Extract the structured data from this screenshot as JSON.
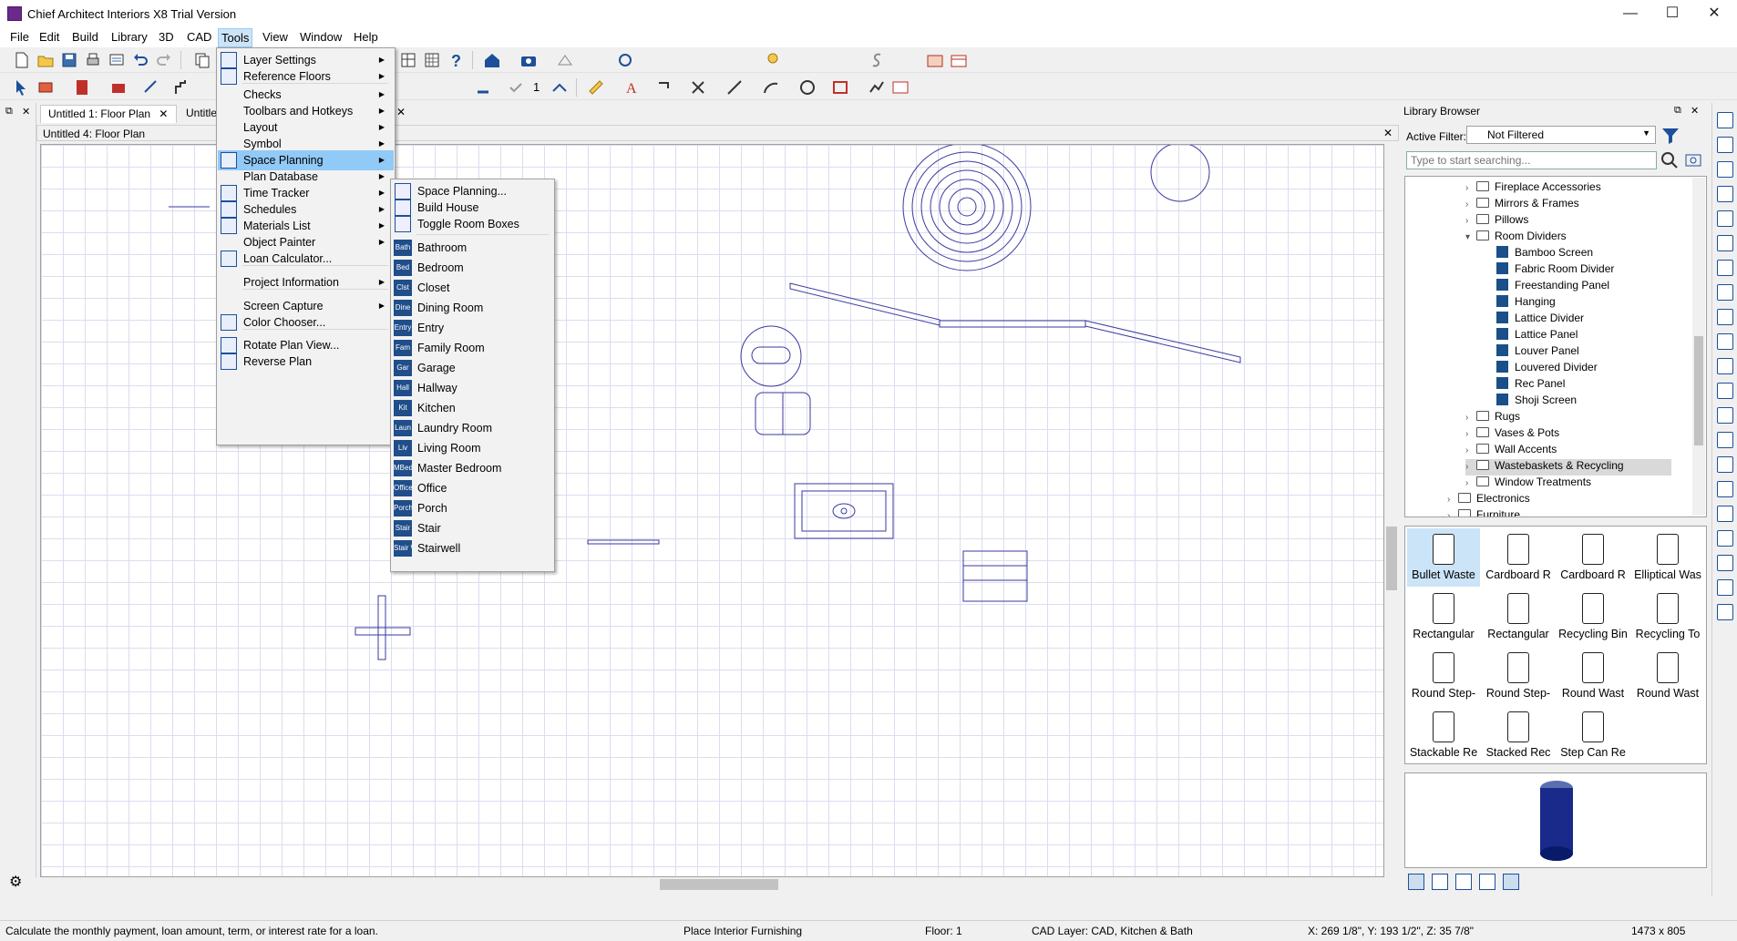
{
  "window": {
    "title": "Chief Architect Interiors X8 Trial Version",
    "minimize": "—",
    "maximize": "☐",
    "close": "✕"
  },
  "menubar": [
    "File",
    "Edit",
    "Build",
    "Library",
    "3D",
    "CAD",
    "Tools",
    "View",
    "Window",
    "Help"
  ],
  "tabs": [
    {
      "label": "Untitled 1: Floor Plan",
      "close": "✕"
    },
    {
      "label": "Untitled",
      "close": "✕"
    }
  ],
  "doc": {
    "header": "Untitled 4: Floor Plan",
    "close": "✕"
  },
  "toolbar": {
    "count": "1"
  },
  "tools_menu": {
    "items": [
      {
        "label": "Layer Settings",
        "submenu": true
      },
      {
        "label": "Reference Floors",
        "submenu": true
      },
      {
        "label": "Checks",
        "submenu": true
      },
      {
        "label": "Toolbars and Hotkeys",
        "submenu": true
      },
      {
        "label": "Layout",
        "submenu": true
      },
      {
        "label": "Symbol",
        "submenu": true
      },
      {
        "label": "Space Planning",
        "submenu": true
      },
      {
        "label": "Plan Database",
        "submenu": true
      },
      {
        "label": "Time Tracker",
        "submenu": true
      },
      {
        "label": "Schedules",
        "submenu": true
      },
      {
        "label": "Materials List",
        "submenu": true
      },
      {
        "label": "Object Painter",
        "submenu": true
      },
      {
        "label": "Loan Calculator...",
        "submenu": false
      },
      {
        "label": "Project Information",
        "submenu": true
      },
      {
        "label": "Screen Capture",
        "submenu": true
      },
      {
        "label": "Color Chooser...",
        "submenu": false
      },
      {
        "label": "Rotate Plan View...",
        "submenu": false
      },
      {
        "label": "Reverse Plan",
        "submenu": false
      }
    ]
  },
  "space_planning_menu": {
    "items": [
      {
        "label": "Space Planning..."
      },
      {
        "label": "Build House"
      },
      {
        "label": "Toggle Room Boxes"
      },
      {
        "label": "Bathroom",
        "icon": "Bath"
      },
      {
        "label": "Bedroom",
        "icon": "Bed"
      },
      {
        "label": "Closet",
        "icon": "Clst"
      },
      {
        "label": "Dining Room",
        "icon": "Dine"
      },
      {
        "label": "Entry",
        "icon": "Entry"
      },
      {
        "label": "Family Room",
        "icon": "Fam"
      },
      {
        "label": "Garage",
        "icon": "Gar"
      },
      {
        "label": "Hallway",
        "icon": "Hall"
      },
      {
        "label": "Kitchen",
        "icon": "Kit"
      },
      {
        "label": "Laundry Room",
        "icon": "Laun"
      },
      {
        "label": "Living Room",
        "icon": "Liv"
      },
      {
        "label": "Master Bedroom",
        "icon": "MBed"
      },
      {
        "label": "Office",
        "icon": "Office"
      },
      {
        "label": "Porch",
        "icon": "Porch"
      },
      {
        "label": "Stair",
        "icon": "Stair"
      },
      {
        "label": "Stairwell",
        "icon": "Stair Well"
      }
    ]
  },
  "library": {
    "title": "Library Browser",
    "filter_label": "Active Filter:",
    "filter_value": "Not Filtered",
    "search_placeholder": "Type to start searching...",
    "tree": [
      {
        "label": "Fireplace Accessories",
        "type": "folder"
      },
      {
        "label": "Mirrors & Frames",
        "type": "folder"
      },
      {
        "label": "Pillows",
        "type": "folder"
      },
      {
        "label": "Room Dividers",
        "type": "folder-open"
      },
      {
        "label": "Bamboo Screen",
        "type": "leaf"
      },
      {
        "label": "Fabric Room Divider",
        "type": "leaf"
      },
      {
        "label": "Freestanding Panel",
        "type": "leaf"
      },
      {
        "label": "Hanging",
        "type": "leaf"
      },
      {
        "label": "Lattice Divider",
        "type": "leaf"
      },
      {
        "label": "Lattice Panel",
        "type": "leaf"
      },
      {
        "label": "Louver Panel",
        "type": "leaf"
      },
      {
        "label": "Louvered Divider",
        "type": "leaf"
      },
      {
        "label": "Rec Panel",
        "type": "leaf"
      },
      {
        "label": "Shoji Screen",
        "type": "leaf"
      },
      {
        "label": "Rugs",
        "type": "folder"
      },
      {
        "label": "Vases & Pots",
        "type": "folder"
      },
      {
        "label": "Wall Accents",
        "type": "folder"
      },
      {
        "label": "Wastebaskets & Recycling",
        "type": "folder"
      },
      {
        "label": "Window Treatments",
        "type": "folder"
      },
      {
        "label": "Electronics",
        "type": "folder"
      },
      {
        "label": "Furniture",
        "type": "folder"
      }
    ],
    "items": [
      "Bullet Waste",
      "Cardboard R",
      "Cardboard R",
      "Elliptical Was",
      "Rectangular",
      "Rectangular",
      "Recycling Bin",
      "Recycling To",
      "Round Step-",
      "Round Step-",
      "Round Wast",
      "Round Wast",
      "Stackable Re",
      "Stacked Rec",
      "Step Can Re"
    ],
    "selected_item": "Bullet Waste"
  },
  "status": {
    "message": "Calculate the monthly payment, loan amount, term, or interest rate for a loan.",
    "mode": "Place Interior Furnishing",
    "floor": "Floor: 1",
    "layer": "CAD Layer: CAD, Kitchen & Bath",
    "coords": "X: 269 1/8\", Y: 193 1/2\", Z: 35 7/8\"",
    "size": "1473 x 805"
  },
  "colors": {
    "accent": "#91c9f7",
    "plan_line": "#3a3aa0",
    "library_blue": "#1f4e8a"
  }
}
